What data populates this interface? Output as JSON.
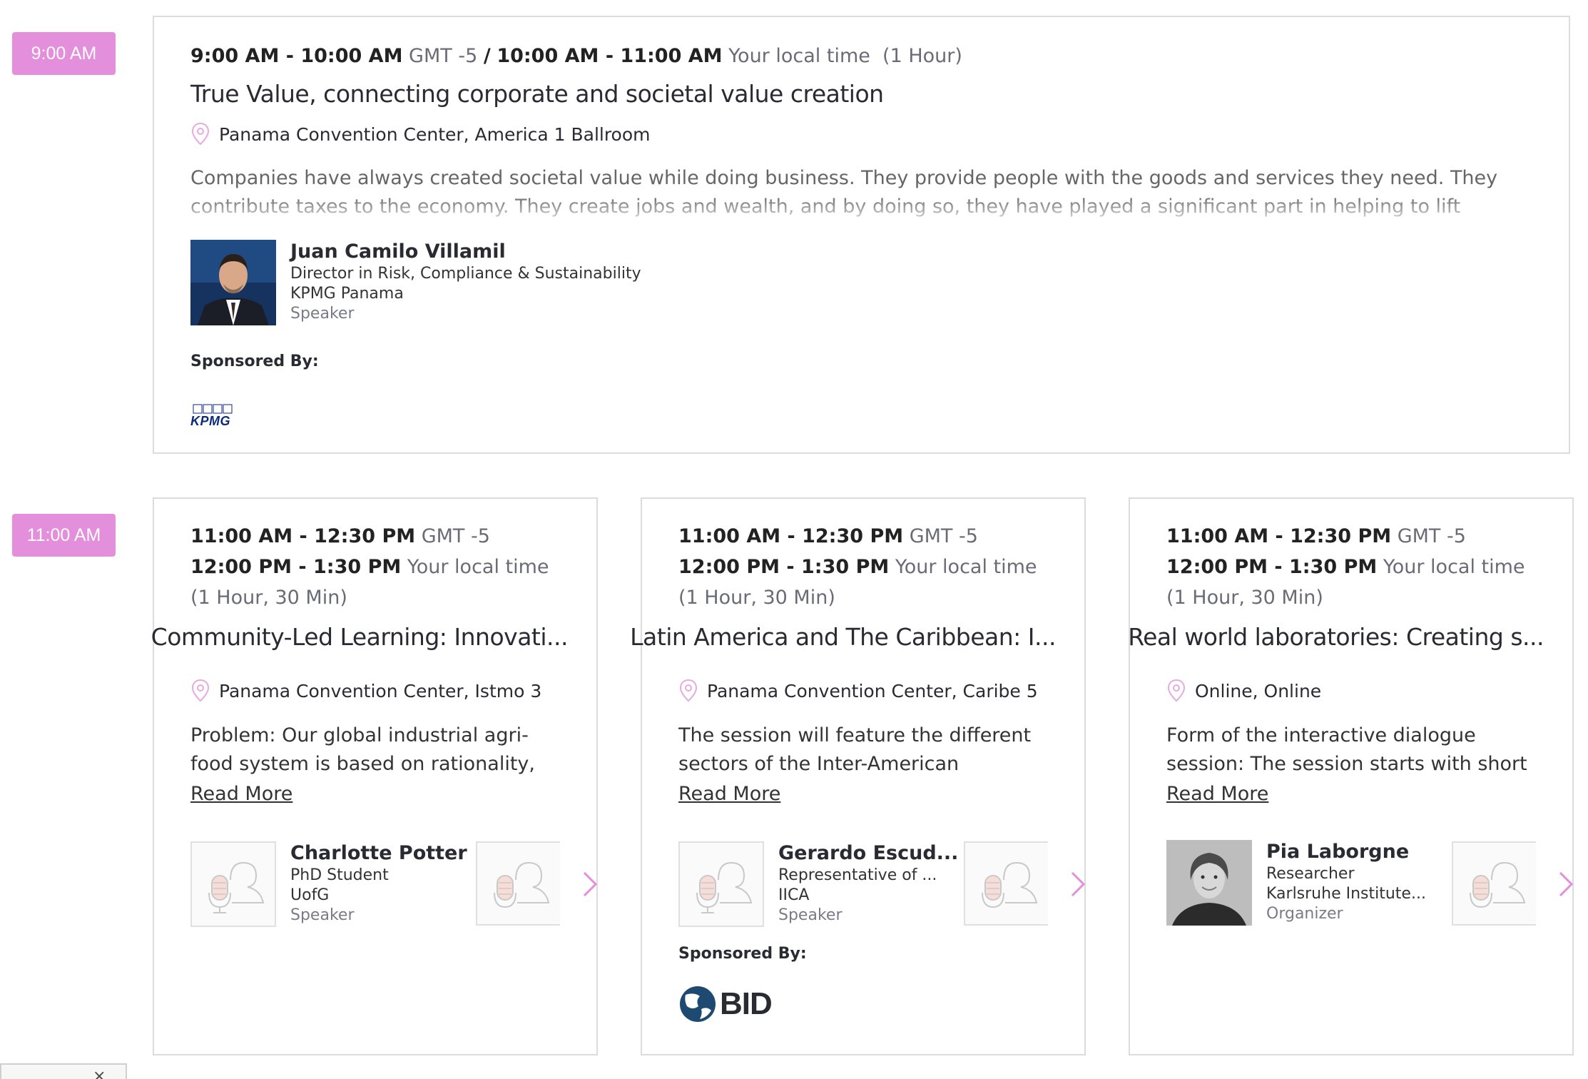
{
  "slots": [
    {
      "time_pill": "9:00 AM",
      "session": {
        "time_primary": "9:00 AM - 10:00 AM",
        "tz_primary": "GMT -5",
        "separator": "/",
        "time_local": "10:00 AM - 11:00 AM",
        "tz_local": "Your local time",
        "duration": "(1 Hour)",
        "title": "True Value, connecting corporate and societal value creation",
        "location": "Panama Convention Center, America 1 Ballroom",
        "description": "Companies have always created societal value while doing business. They provide people with the goods and services they need. They contribute taxes to the economy. They create jobs and wealth, and by doing so, they have played a significant part in helping to lift hundreds of millions out of poverty.",
        "speaker": {
          "name": "Juan Camilo Villamil",
          "title": "Director in Risk, Compliance & Sustainability",
          "org": "KPMG Panama",
          "role": "Speaker"
        },
        "sponsored_label": "Sponsored By:",
        "sponsor_logo": "KPMG"
      }
    },
    {
      "time_pill": "11:00 AM",
      "sessions": [
        {
          "time_primary": "11:00 AM - 12:30 PM",
          "tz_primary": "GMT -5",
          "time_local": "12:00 PM - 1:30 PM",
          "tz_local": "Your local time",
          "duration": "(1 Hour, 30 Min)",
          "title": "Community-Led Learning: Innovati...",
          "location": "Panama Convention Center, Istmo 3",
          "description": "Problem: Our global industrial agri-food system is based on rationality, productivity,",
          "read_more": "Read More",
          "speaker": {
            "name": "Charlotte Potter",
            "title": "PhD Student",
            "org": "UofG",
            "role": "Speaker"
          }
        },
        {
          "time_primary": "11:00 AM - 12:30 PM",
          "tz_primary": "GMT -5",
          "time_local": "12:00 PM - 1:30 PM",
          "tz_local": "Your local time",
          "duration": "(1 Hour, 30 Min)",
          "title": "Latin America and The Caribbean: I...",
          "location": "Panama Convention Center, Caribe 5",
          "description": "The session will feature the different sectors of the Inter-American Development",
          "read_more": "Read More",
          "speaker": {
            "name": "Gerardo Escud...",
            "title": "Representative of ...",
            "org": "IICA",
            "role": "Speaker"
          },
          "sponsored_label": "Sponsored By:",
          "sponsor_logo": "BID"
        },
        {
          "time_primary": "11:00 AM - 12:30 PM",
          "tz_primary": "GMT -5",
          "time_local": "12:00 PM - 1:30 PM",
          "tz_local": "Your local time",
          "duration": "(1 Hour, 30 Min)",
          "title": "Real world laboratories: Creating s...",
          "location": "Online, Online",
          "description": "Form of the interactive dialogue session: The session starts with short inputs",
          "read_more": "Read More",
          "speaker": {
            "name": "Pia Laborgne",
            "title": "Researcher",
            "org": "Karlsruhe Institute...",
            "role": "Organizer"
          }
        }
      ]
    }
  ],
  "colors": {
    "accent": "#e38fdb",
    "border": "#dcdcdc",
    "text": "#2a2a33",
    "muted": "#6b6b78"
  },
  "bottom_widget": {
    "close": "×"
  }
}
